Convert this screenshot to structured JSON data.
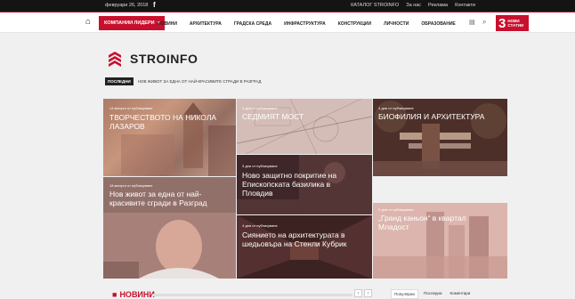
{
  "topbar": {
    "date": "февруари 26, 2018",
    "fb_icon": "f",
    "links": [
      "КАТАЛОГ STROINFO",
      "За нас",
      "Реклама",
      "Контакти"
    ]
  },
  "nav": {
    "home_icon": "⌂",
    "featured_label": "КОМПАНИИ ЛИДЕРИ",
    "featured_caret": "▾",
    "items": [
      "НОВИНИ",
      "АРХИТЕКТУРА",
      "ГРАДСКА СРЕДА",
      "ИНФРАСТРУКТУРА",
      "КОНСТРУКЦИИ",
      "ЛИЧНОСТИ",
      "ОБРАЗОВАНИЕ"
    ],
    "news_icon": "▤",
    "search_icon": "⌕",
    "badge_num": "3",
    "badge_line1": "НОВИ",
    "badge_line2": "СТАТИИ"
  },
  "logo": {
    "text": "STROINFO"
  },
  "ticker": {
    "tag": "ПОСЛЕДНИ",
    "text": "НОВ ЖИВОТ ЗА ЕДНА ОТ НАЙ-КРАСИВИТЕ СГРАДИ В РАЗГРАД"
  },
  "tiles": [
    {
      "time": "14 минути от публикуване",
      "title": "ТВОРЧЕСТВОТО НА НИКОЛА ЛАЗАРОВ"
    },
    {
      "time": "2 дни от публикуване",
      "title": "СЕДМИЯТ МОСТ"
    },
    {
      "time": "4 дни от публикуване",
      "title": "БИОФИЛИЯ И АРХИТЕКТУРА"
    },
    {
      "time": "3 дни от публикуване",
      "title": "Ново защитно покритие на Епископската базилика в Пловдив"
    },
    {
      "time": "18 минути от публикуване",
      "title": "Нов живот за една от най-красивите сгради в Разград"
    },
    {
      "time": "4 дни от публикуване",
      "title": "Сиянието на архитектурата в шедьовъра на Стенли Кубрик"
    },
    {
      "time": "5 дни от публикуване",
      "title": "„Гранд каньон“ в квартал Младост"
    }
  ],
  "section": {
    "marker": "■",
    "title": "НОВИНИ",
    "prev": "‹",
    "next": "›"
  },
  "tabs": [
    "Популярни",
    "Последни",
    "Коментари"
  ],
  "colors": {
    "accent": "#c8102e",
    "dark": "#141414"
  }
}
